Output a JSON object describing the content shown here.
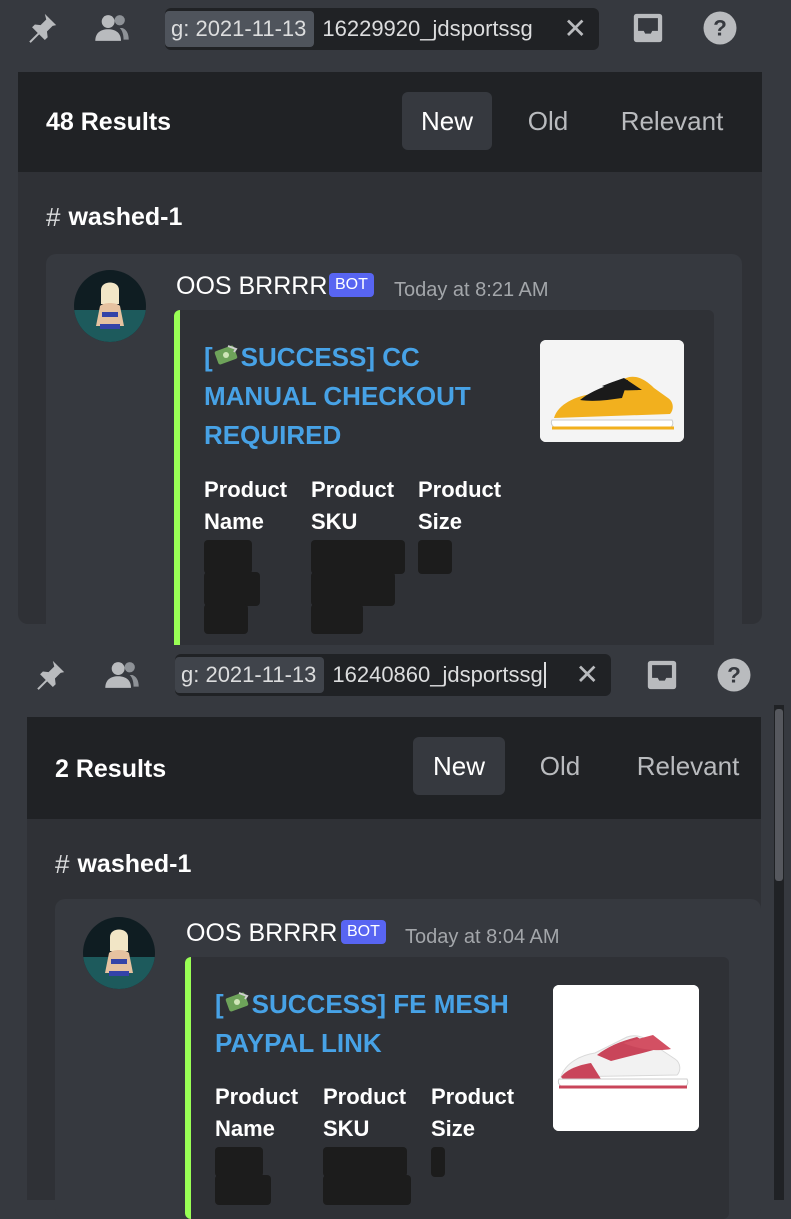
{
  "panels": [
    {
      "search": {
        "tag": "g: 2021-11-13",
        "query": "16229920_jdsportssg"
      },
      "results": {
        "count_label": "48 Results"
      },
      "sort": [
        "New",
        "Old",
        "Relevant"
      ],
      "channel": "washed-1",
      "message": {
        "author": "OOS BRRRR",
        "badge": "BOT",
        "time": "Today at 8:21 AM",
        "embed": {
          "title_bracket": "[",
          "title_text": "SUCCESS] CC",
          "title_line2": "MANUAL CHECKOUT",
          "title_line3": "REQUIRED",
          "fields": [
            {
              "l1": "Product",
              "l2": "Name"
            },
            {
              "l1": "Product",
              "l2": "SKU"
            },
            {
              "l1": "Product",
              "l2": "Size"
            }
          ]
        }
      }
    },
    {
      "search": {
        "tag": "g: 2021-11-13",
        "query": "16240860_jdsportssg"
      },
      "results": {
        "count_label": "2 Results"
      },
      "sort": [
        "New",
        "Old",
        "Relevant"
      ],
      "channel": "washed-1",
      "message": {
        "author": "OOS BRRRR",
        "badge": "BOT",
        "time": "Today at 8:04 AM",
        "embed": {
          "title_bracket": "[",
          "title_text": "SUCCESS] FE MESH",
          "title_line2": "PAYPAL LINK",
          "fields": [
            {
              "l1": "Product",
              "l2": "Name"
            },
            {
              "l1": "Product",
              "l2": "SKU"
            },
            {
              "l1": "Product",
              "l2": "Size"
            }
          ]
        }
      }
    }
  ],
  "icons": [
    "pin-icon",
    "members-icon",
    "clear-icon",
    "inbox-icon",
    "help-icon",
    "channel-hash-icon",
    "money-emoji-icon"
  ],
  "colors": {
    "accent": "#5865f2",
    "embed_bar": "#99ff55",
    "link": "#47a2e6",
    "background": "#36393f",
    "header": "#202225"
  }
}
